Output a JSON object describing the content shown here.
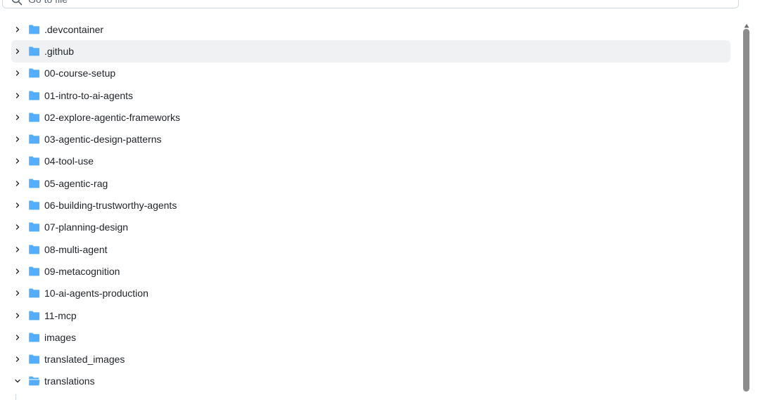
{
  "search": {
    "placeholder": "Go to file",
    "icon": "search-icon"
  },
  "tree": {
    "selected_index": 1,
    "items": [
      {
        "label": ".devcontainer",
        "expanded": false,
        "icon": "folder-icon"
      },
      {
        "label": ".github",
        "expanded": false,
        "icon": "folder-icon"
      },
      {
        "label": "00-course-setup",
        "expanded": false,
        "icon": "folder-icon"
      },
      {
        "label": "01-intro-to-ai-agents",
        "expanded": false,
        "icon": "folder-icon"
      },
      {
        "label": "02-explore-agentic-frameworks",
        "expanded": false,
        "icon": "folder-icon"
      },
      {
        "label": "03-agentic-design-patterns",
        "expanded": false,
        "icon": "folder-icon"
      },
      {
        "label": "04-tool-use",
        "expanded": false,
        "icon": "folder-icon"
      },
      {
        "label": "05-agentic-rag",
        "expanded": false,
        "icon": "folder-icon"
      },
      {
        "label": "06-building-trustworthy-agents",
        "expanded": false,
        "icon": "folder-icon"
      },
      {
        "label": "07-planning-design",
        "expanded": false,
        "icon": "folder-icon"
      },
      {
        "label": "08-multi-agent",
        "expanded": false,
        "icon": "folder-icon"
      },
      {
        "label": "09-metacognition",
        "expanded": false,
        "icon": "folder-icon"
      },
      {
        "label": "10-ai-agents-production",
        "expanded": false,
        "icon": "folder-icon"
      },
      {
        "label": "11-mcp",
        "expanded": false,
        "icon": "folder-icon"
      },
      {
        "label": "images",
        "expanded": false,
        "icon": "folder-icon"
      },
      {
        "label": "translated_images",
        "expanded": false,
        "icon": "folder-icon"
      },
      {
        "label": "translations",
        "expanded": true,
        "icon": "folder-open-icon"
      }
    ]
  },
  "colors": {
    "folder": "#54aeff",
    "selected_row": "#eff1f3",
    "text": "#1f2328",
    "muted": "#59636e",
    "scrollbar_thumb": "#8c8c8c"
  }
}
